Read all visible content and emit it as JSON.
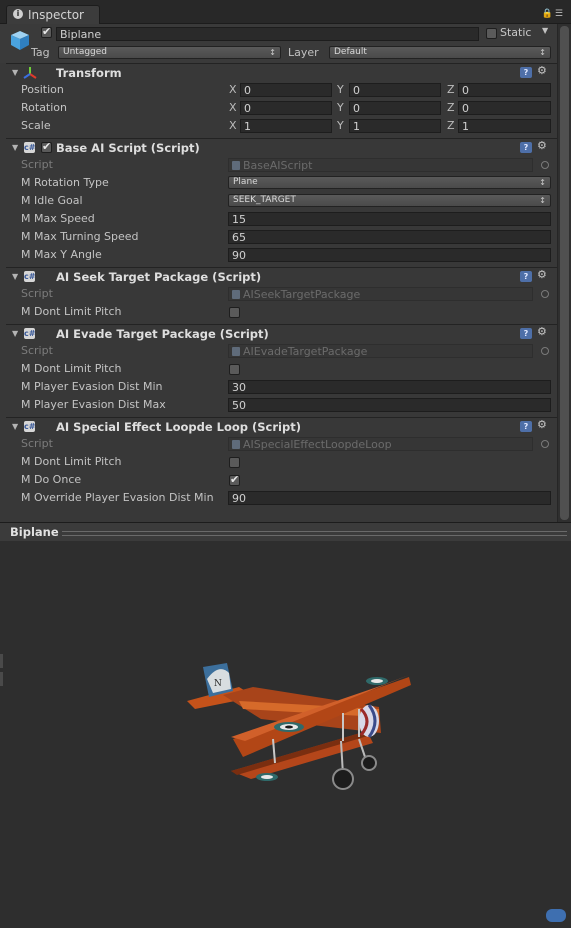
{
  "window": {
    "tab_label": "Inspector"
  },
  "object": {
    "name": "Biplane",
    "active": true,
    "static_label": "Static",
    "static_checked": false,
    "tag_label": "Tag",
    "tag_value": "Untagged",
    "layer_label": "Layer",
    "layer_value": "Default"
  },
  "transform": {
    "title": "Transform",
    "rows": [
      {
        "label": "Position",
        "x": "0",
        "y": "0",
        "z": "0"
      },
      {
        "label": "Rotation",
        "x": "0",
        "y": "0",
        "z": "0"
      },
      {
        "label": "Scale",
        "x": "1",
        "y": "1",
        "z": "1"
      }
    ],
    "axis_x": "X",
    "axis_y": "Y",
    "axis_z": "Z"
  },
  "base_ai": {
    "title": "Base AI Script (Script)",
    "enabled": true,
    "script_label": "Script",
    "script_value": "BaseAIScript",
    "rotation_type_label": "M Rotation Type",
    "rotation_type_value": "Plane",
    "idle_goal_label": "M Idle Goal",
    "idle_goal_value": "SEEK_TARGET",
    "max_speed_label": "M Max Speed",
    "max_speed_value": "15",
    "max_turning_label": "M Max Turning Speed",
    "max_turning_value": "65",
    "max_y_label": "M Max Y Angle",
    "max_y_value": "90"
  },
  "seek": {
    "title": "AI Seek Target Package (Script)",
    "script_label": "Script",
    "script_value": "AISeekTargetPackage",
    "dont_limit_label": "M Dont Limit Pitch",
    "dont_limit_checked": false
  },
  "evade": {
    "title": "AI Evade Target Package (Script)",
    "script_label": "Script",
    "script_value": "AIEvadeTargetPackage",
    "dont_limit_label": "M Dont Limit Pitch",
    "dont_limit_checked": false,
    "min_label": "M Player Evasion Dist Min",
    "min_value": "30",
    "max_label": "M Player Evasion Dist Max",
    "max_value": "50"
  },
  "loop": {
    "title": "AI Special Effect Loopde Loop (Script)",
    "script_label": "Script",
    "script_value": "AISpecialEffectLoopdeLoop",
    "dont_limit_label": "M Dont Limit Pitch",
    "dont_limit_checked": false,
    "do_once_label": "M Do Once",
    "do_once_checked": true,
    "override_label": "M Override Player Evasion Dist Min",
    "override_value": "90"
  },
  "preview": {
    "title": "Biplane",
    "roundel_letter": "N"
  },
  "colors": {
    "background": "#383838",
    "preview_bg": "#2e2e2e",
    "plane_orange": "#c4521a",
    "help_blue": "#4e6fa8"
  },
  "icons": [
    "info-icon",
    "lock-icon",
    "menu-icon",
    "cube-icon",
    "transform-axis-icon",
    "script-icon",
    "help-icon",
    "gear-icon",
    "object-picker-icon",
    "tag-icon"
  ]
}
